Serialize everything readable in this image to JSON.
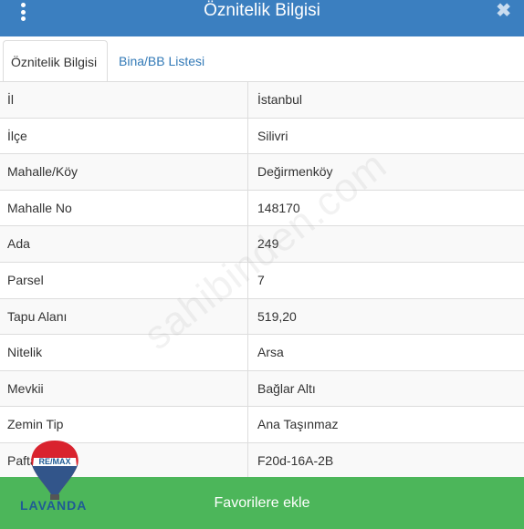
{
  "header": {
    "title": "Öznitelik Bilgisi",
    "menu_icon": "vertical-dots-icon",
    "close_icon": "close-icon",
    "close_glyph": "✖"
  },
  "tabs": [
    {
      "label": "Öznitelik Bilgisi",
      "active": true
    },
    {
      "label": "Bina/BB Listesi",
      "active": false
    }
  ],
  "rows": [
    {
      "label": "İl",
      "value": "İstanbul"
    },
    {
      "label": "İlçe",
      "value": "Silivri"
    },
    {
      "label": "Mahalle/Köy",
      "value": "Değirmenköy"
    },
    {
      "label": "Mahalle No",
      "value": "148170"
    },
    {
      "label": "Ada",
      "value": "249"
    },
    {
      "label": "Parsel",
      "value": "7"
    },
    {
      "label": "Tapu Alanı",
      "value": "519,20"
    },
    {
      "label": "Nitelik",
      "value": "Arsa"
    },
    {
      "label": "Mevkii",
      "value": "Bağlar Altı"
    },
    {
      "label": "Zemin Tip",
      "value": "Ana Taşınmaz"
    },
    {
      "label": "Pafta",
      "value": "F20d-16A-2B"
    }
  ],
  "footer": {
    "button_label": "Favorilere ekle"
  },
  "watermark": "sahibinden.com",
  "logo": {
    "brand_text": "LAVANDA",
    "balloon_text": "RE/MAX"
  },
  "colors": {
    "header_bg": "#3b7fc0",
    "footer_bg": "#4cb65a",
    "link": "#337ab7"
  }
}
